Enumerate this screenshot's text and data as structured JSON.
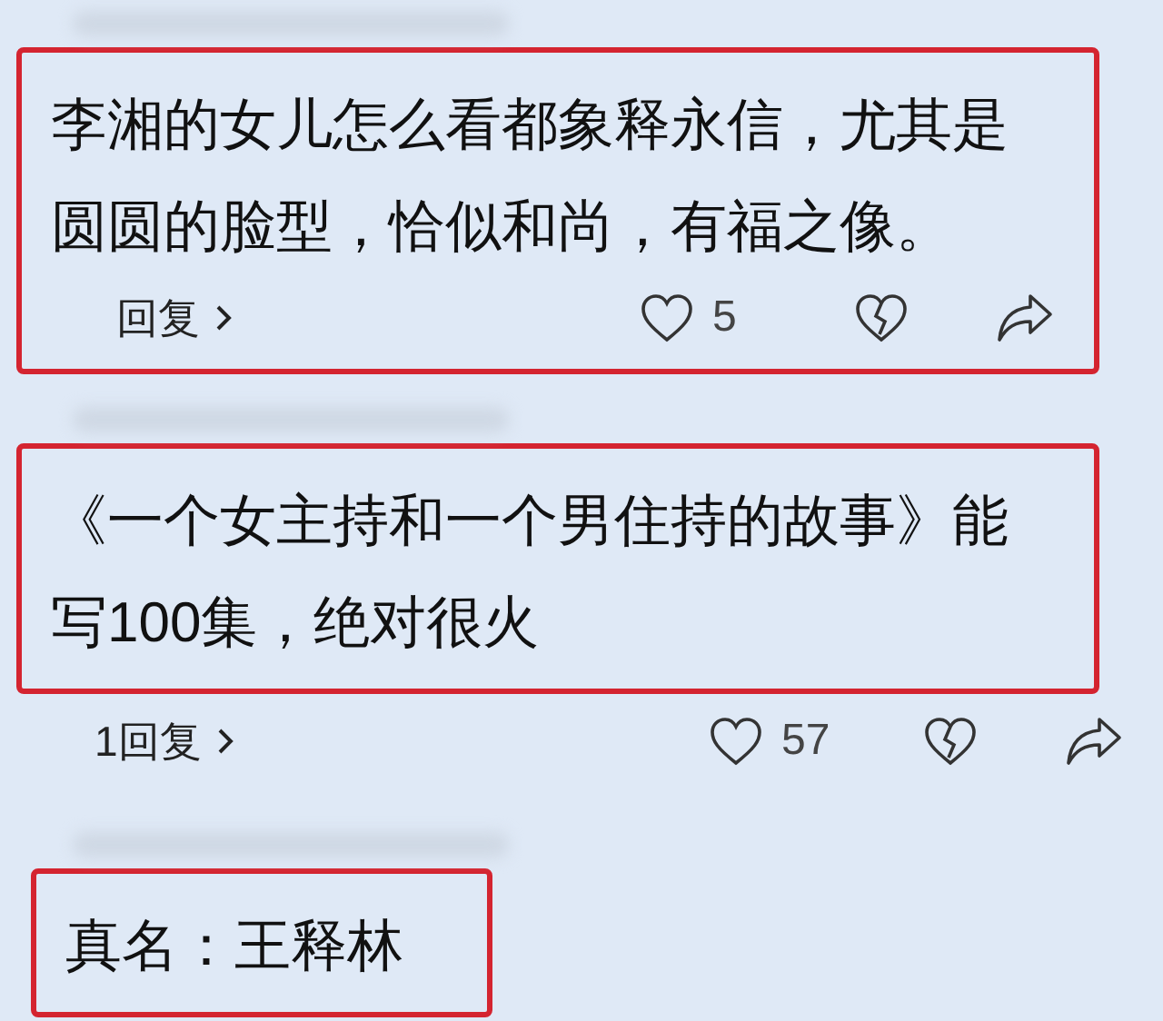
{
  "comments": [
    {
      "text": "李湘的女儿怎么看都象释永信，尤其是圆圆的脸型，恰似和尚，有福之像。",
      "highlighted": true,
      "actions": {
        "reply": "回复",
        "likes": "5"
      }
    },
    {
      "text": "《一个女主持和一个男住持的故事》能写100集，绝对很火",
      "highlighted": true,
      "actions": {
        "reply": "1回复",
        "likes": "57"
      }
    },
    {
      "text": "真名：王释林",
      "highlighted": true
    }
  ]
}
